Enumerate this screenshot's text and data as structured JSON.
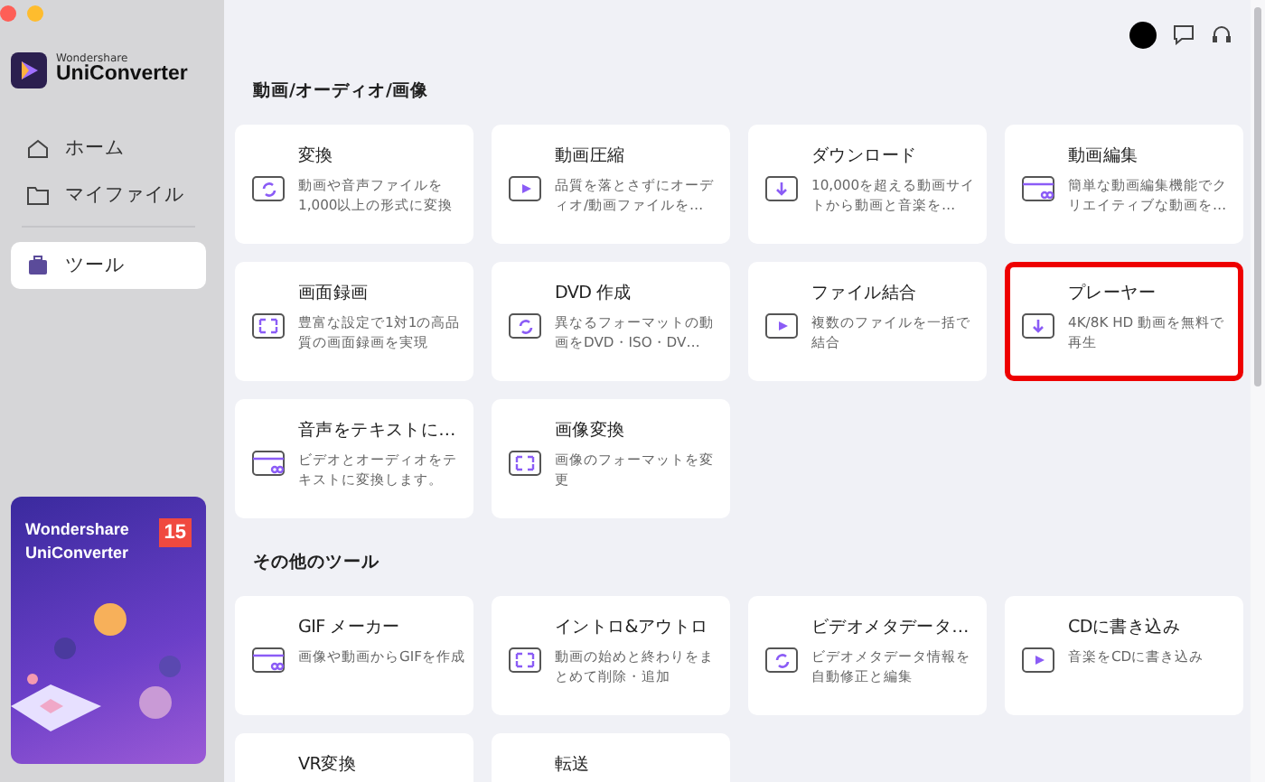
{
  "sidebar": {
    "logo": {
      "brand": "Wondershare",
      "product": "UniConverter"
    },
    "items": [
      {
        "label": "ホーム",
        "selected": false
      },
      {
        "label": "マイファイル",
        "selected": false
      },
      {
        "label": "ツール",
        "selected": true
      }
    ],
    "promo": {
      "title": "Wondershare UniConverter",
      "badge": "15"
    }
  },
  "sections": [
    {
      "title": "動画/オーディオ/画像",
      "cards": [
        {
          "title": "変換",
          "description": "動画や音声ファイルを1,000以上の形式に変換",
          "highlighted": false
        },
        {
          "title": "動画圧縮",
          "description": "品質を落とさずにオーディオ/動画ファイルを…",
          "highlighted": false
        },
        {
          "title": "ダウンロード",
          "description": "10,000を超える動画サイトから動画と音楽を…",
          "highlighted": false
        },
        {
          "title": "動画編集",
          "description": "簡単な動画編集機能でクリエイティブな動画を…",
          "highlighted": false
        },
        {
          "title": "画面録画",
          "description": "豊富な設定で1対1の高品質の画面録画を実現",
          "highlighted": false
        },
        {
          "title": "DVD 作成",
          "description": "異なるフォーマットの動画をDVD・ISO・DV…",
          "highlighted": false
        },
        {
          "title": "ファイル結合",
          "description": "複数のファイルを一括で結合",
          "highlighted": false
        },
        {
          "title": "プレーヤー",
          "description": "4K/8K HD 動画を無料で再生",
          "highlighted": true
        },
        {
          "title": "音声をテキストに…",
          "description": "ビデオとオーディオをテキストに変換します。",
          "highlighted": false
        },
        {
          "title": "画像変換",
          "description": "画像のフォーマットを変更",
          "highlighted": false
        }
      ]
    },
    {
      "title": "その他のツール",
      "cards": [
        {
          "title": "GIF メーカー",
          "description": "画像や動画からGIFを作成",
          "highlighted": false
        },
        {
          "title": "イントロ&アウトロ",
          "description": "動画の始めと終わりをまとめて削除・追加",
          "highlighted": false
        },
        {
          "title": "ビデオメタデータ…",
          "description": "ビデオメタデータ情報を自動修正と編集",
          "highlighted": false
        },
        {
          "title": "CDに書き込み",
          "description": "音楽をCDに書き込み",
          "highlighted": false
        },
        {
          "title": "VR変換",
          "highlighted": false
        },
        {
          "title": "転送",
          "highlighted": false
        }
      ]
    }
  ]
}
